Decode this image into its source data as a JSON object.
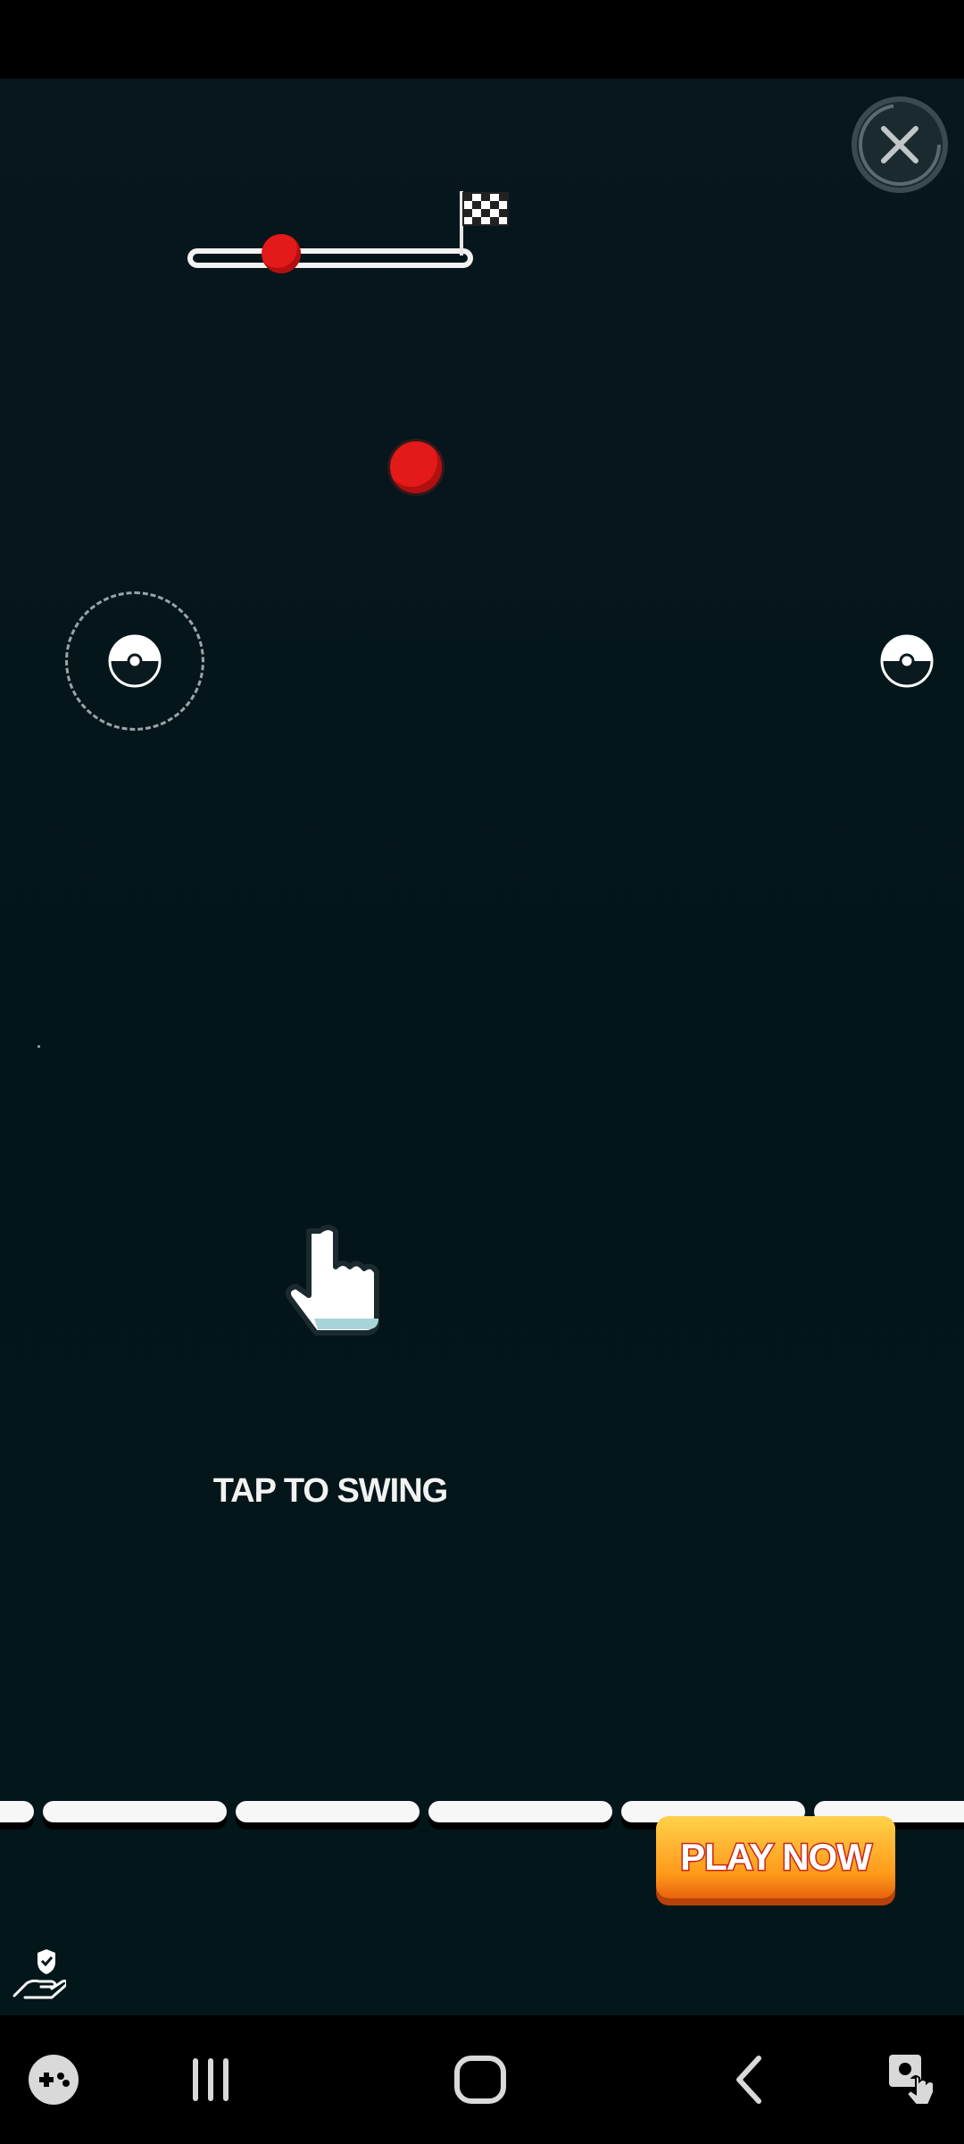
{
  "game": {
    "instruction": "TAP TO SWING",
    "cta_label": "PLAY NOW",
    "progress": 0.3,
    "colors": {
      "background": "#04151a",
      "ball": "#e3191a",
      "platform": "#f7f7f7",
      "cta": "#ff9a1a"
    }
  },
  "icons": {
    "close": "close-icon",
    "flag": "checkered-flag-icon",
    "hand": "pointing-hand-icon",
    "privacy": "ad-privacy-icon"
  },
  "nav": {
    "items": [
      "game-launcher-icon",
      "recent-apps-icon",
      "home-icon",
      "back-icon",
      "accessibility-icon"
    ]
  }
}
